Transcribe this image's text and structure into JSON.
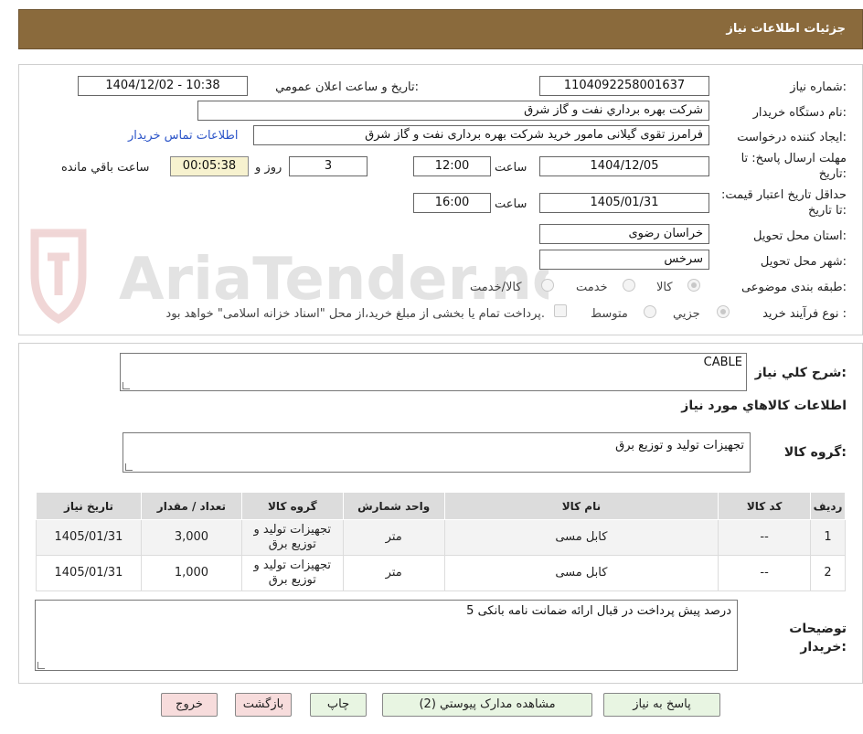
{
  "header": {
    "title": "جزئیات اطلاعات نیاز"
  },
  "watermark": {
    "text": "AriaTender.neT"
  },
  "form": {
    "need_number_label": "شماره نیاز:",
    "need_number": "1104092258001637",
    "announce_label": "تاریخ و ساعت اعلان عمومي:",
    "announce_value": "1404/12/02 - 10:38",
    "buyer_org_label": "نام دستگاه خريدار:",
    "buyer_org": "شركت بهره برداري نفت و گاز شرق",
    "creator_label": "ايجاد كننده درخواست:",
    "creator": "فرامرز تقوی گیلانی مامور خرید شرکت بهره برداری نفت و گاز شرق",
    "contact_link": "اطلاعات تماس خريدار",
    "deadline_label": "مهلت ارسال پاسخ: تا تاريخ:",
    "deadline_date": "1404/12/05",
    "time_label": "ساعت",
    "deadline_time": "12:00",
    "days_value": "3",
    "days_label": "روز و",
    "timer_value": "00:05:38",
    "remaining_label": "ساعت باقي مانده",
    "validity_label": "حداقل تاريخ اعتبار قيمت: تا تاريخ:",
    "validity_date": "1405/01/31",
    "validity_time": "16:00",
    "province_label": "استان محل تحويل:",
    "province": "خراسان رضوی",
    "city_label": "شهر محل تحويل:",
    "city": "سرخس",
    "category_label": "طبقه بندی موضوعی:",
    "category_options": [
      "كالا",
      "خدمت",
      "كالا/خدمت"
    ],
    "process_label": "نوع فرآيند خريد :",
    "process_options": [
      "جزيي",
      "متوسط"
    ],
    "payment_note": "پرداخت تمام يا بخشی از مبلغ خريد،از محل \"اسناد خزانه اسلامی\" خواهد بود."
  },
  "summary": {
    "general_desc_label": "شرح كلي نياز:",
    "general_desc": "CABLE",
    "goods_info_title": "اطلاعات كالاهاي مورد نياز",
    "goods_group_label": "گروه كالا:",
    "goods_group": "تجهیزات تولید و توزیع برق"
  },
  "table": {
    "headers": [
      "رديف",
      "كد كالا",
      "نام كالا",
      "واحد شمارش",
      "گروه كالا",
      "تعداد / مقدار",
      "تاريخ نياز"
    ],
    "rows": [
      [
        "1",
        "--",
        "کابل مسی",
        "متر",
        "تجهیزات تولید و توزیع برق",
        "3,000",
        "1405/01/31"
      ],
      [
        "2",
        "--",
        "کابل مسی",
        "متر",
        "تجهیزات تولید و توزیع برق",
        "1,000",
        "1405/01/31"
      ]
    ]
  },
  "buyer_notes": {
    "label": "توضيحات خريدار:",
    "text": "5 درصد پیش پرداخت در قبال ارائه ضمانت نامه بانکی"
  },
  "buttons": {
    "reply": "پاسخ به نياز",
    "attachments": "مشاهده مدارک پيوستي (2)",
    "print": "چاپ",
    "back": "بازگشت",
    "exit": "خروج"
  },
  "colors": {
    "header_bg": "#8a6a3c",
    "link": "#2b54c8",
    "timer_bg": "#f7f2cf",
    "green_button": "#e8f5e2",
    "pink_button": "#f7dcdc"
  }
}
